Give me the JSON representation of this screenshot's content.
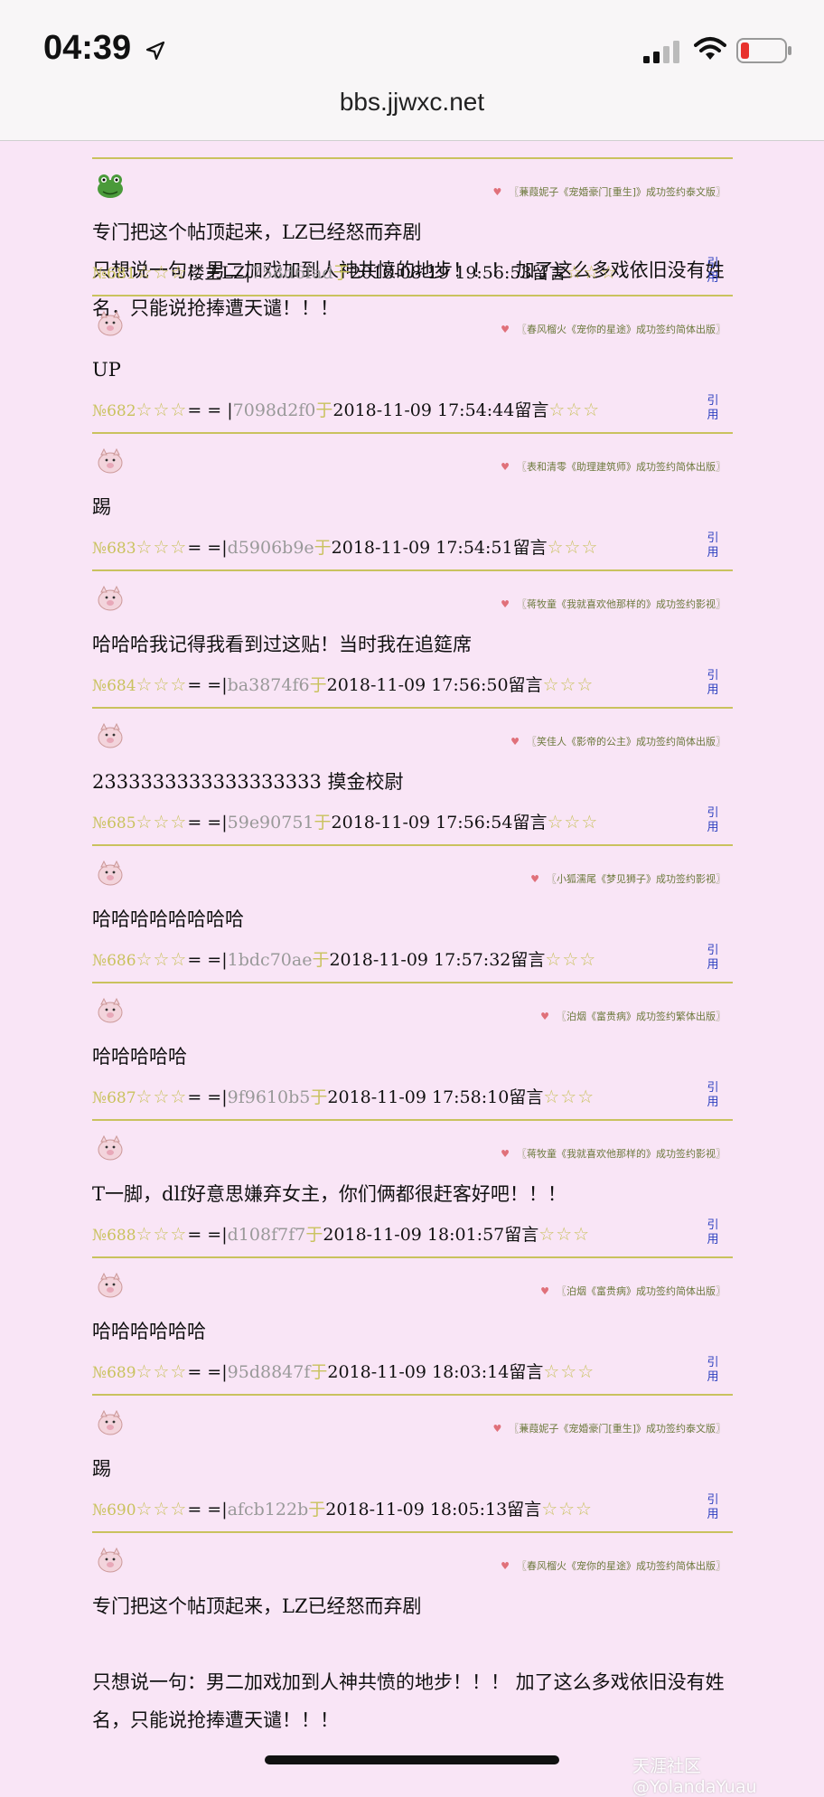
{
  "status_bar": {
    "time": "04:39",
    "url": "bbs.jjwxc.net"
  },
  "colors": {
    "background": "#f9e5f6",
    "accent": "#c9c25e",
    "link": "#2b3fbf"
  },
  "reply_label": "引用",
  "posts": [
    {
      "avatar": "frog",
      "signature": "〖蒹葭妮子《宠婚豪门[重生]》成功签约泰文版〗",
      "content": [
        "专门把这个帖顶起来，LZ已经怒而弃剧",
        "只想说一句：男二加戏加到人神共愤的地步！！！ 加了这么多戏依旧没有姓名，只能说抢捧遭天谴！！！"
      ],
      "num": "№681",
      "stars_left": "☆☆☆",
      "user": "楼主LZ",
      "sep": "|",
      "hash": "758d6fad",
      "yu": "于",
      "datetime": "2018-08-19 19:56:53",
      "action": "留言",
      "stars_right": "☆☆☆"
    },
    {
      "avatar": "pig",
      "signature": "〖春风榴火《宠你的星途》成功签约简体出版〗",
      "content": [
        "UP"
      ],
      "num": "№682",
      "stars_left": "☆☆☆",
      "user": "= = ",
      "sep": "|",
      "hash": "7098d2f0",
      "yu": "于",
      "datetime": "2018-11-09 17:54:44",
      "action": "留言",
      "stars_right": "☆☆☆"
    },
    {
      "avatar": "pig",
      "signature": "〖表和清零《助理建筑师》成功签约简体出版〗",
      "content": [
        "踢"
      ],
      "num": "№683",
      "stars_left": "☆☆☆",
      "user": "= =",
      "sep": "|",
      "hash": "d5906b9e",
      "yu": "于",
      "datetime": "2018-11-09 17:54:51",
      "action": "留言",
      "stars_right": "☆☆☆"
    },
    {
      "avatar": "pig",
      "signature": "〖蒋牧童《我就喜欢他那样的》成功签约影视〗",
      "content": [
        "哈哈哈我记得我看到过这贴！当时我在追筵席"
      ],
      "num": "№684",
      "stars_left": "☆☆☆",
      "user": "= =",
      "sep": "|",
      "hash": "ba3874f6",
      "yu": "于",
      "datetime": "2018-11-09 17:56:50",
      "action": "留言",
      "stars_right": "☆☆☆"
    },
    {
      "avatar": "pig",
      "signature": "〖笑佳人《影帝的公主》成功签约简体出版〗",
      "content": [
        "2333333333333333333 摸金校尉"
      ],
      "num": "№685",
      "stars_left": "☆☆☆",
      "user": "= =",
      "sep": "|",
      "hash": "59e90751",
      "yu": "于",
      "datetime": "2018-11-09 17:56:54",
      "action": "留言",
      "stars_right": "☆☆☆"
    },
    {
      "avatar": "pig",
      "signature": "〖小狐濡尾《梦见狮子》成功签约影视〗",
      "content": [
        "哈哈哈哈哈哈哈哈"
      ],
      "num": "№686",
      "stars_left": "☆☆☆",
      "user": "= =",
      "sep": "|",
      "hash": "1bdc70ae",
      "yu": "于",
      "datetime": "2018-11-09 17:57:32",
      "action": "留言",
      "stars_right": "☆☆☆"
    },
    {
      "avatar": "pig",
      "signature": "〖泊烟《富贵病》成功签约繁体出版〗",
      "content": [
        "哈哈哈哈哈"
      ],
      "num": "№687",
      "stars_left": "☆☆☆",
      "user": "= =",
      "sep": "|",
      "hash": "9f9610b5",
      "yu": "于",
      "datetime": "2018-11-09 17:58:10",
      "action": "留言",
      "stars_right": "☆☆☆"
    },
    {
      "avatar": "pig",
      "signature": "〖蒋牧童《我就喜欢他那样的》成功签约影视〗",
      "content": [
        "T一脚，dlf好意思嫌弃女主，你们俩都很赶客好吧！！！"
      ],
      "num": "№688",
      "stars_left": "☆☆☆",
      "user": "= =",
      "sep": "|",
      "hash": "d108f7f7",
      "yu": "于",
      "datetime": "2018-11-09 18:01:57",
      "action": "留言",
      "stars_right": "☆☆☆"
    },
    {
      "avatar": "pig",
      "signature": "〖泊烟《富贵病》成功签约简体出版〗",
      "content": [
        "哈哈哈哈哈哈"
      ],
      "num": "№689",
      "stars_left": "☆☆☆",
      "user": "= =",
      "sep": "|",
      "hash": "95d8847f",
      "yu": "于",
      "datetime": "2018-11-09 18:03:14",
      "action": "留言",
      "stars_right": "☆☆☆"
    },
    {
      "avatar": "pig",
      "signature": "〖蒹葭妮子《宠婚豪门[重生]》成功签约泰文版〗",
      "content": [
        "踢"
      ],
      "num": "№690",
      "stars_left": "☆☆☆",
      "user": "= =",
      "sep": "|",
      "hash": "afcb122b",
      "yu": "于",
      "datetime": "2018-11-09 18:05:13",
      "action": "留言",
      "stars_right": "☆☆☆"
    },
    {
      "avatar": "pig",
      "signature": "〖春风榴火《宠你的星途》成功签约简体出版〗",
      "content": [
        "专门把这个帖顶起来，LZ已经怒而弃剧",
        "",
        "只想说一句：男二加戏加到人神共愤的地步！！！ 加了这么多戏依旧没有姓名，只能说抢捧遭天谴！！！"
      ],
      "num": "",
      "stars_left": "",
      "user": "",
      "sep": "",
      "hash": "",
      "yu": "",
      "datetime": "",
      "action": "",
      "stars_right": ""
    }
  ],
  "watermark": "天涯社区@YolandaYuau"
}
